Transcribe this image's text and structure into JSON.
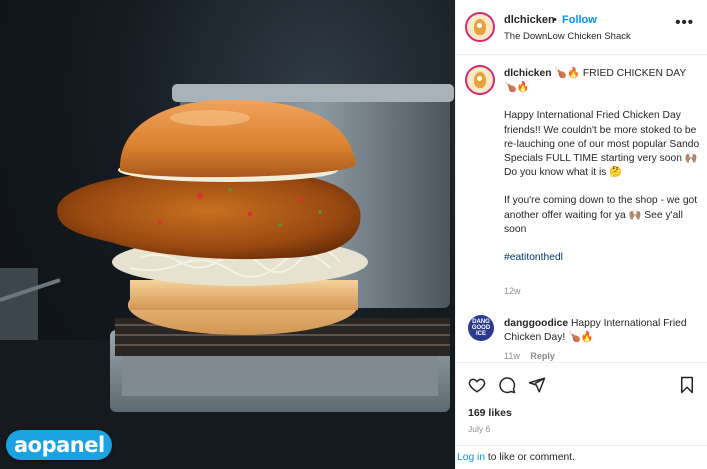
{
  "post": {
    "username": "dlchicken",
    "dot": "•",
    "follow_label": "Follow",
    "subtitle": "The DownLow Chicken Shack",
    "more_label": "•••"
  },
  "caption": {
    "username": "dlchicken",
    "headline": "🍗🔥 FRIED CHICKEN DAY 🍗🔥",
    "paragraph1": "Happy International Fried Chicken Day friends!! We couldn't be more stoked to be re-lauching one of our most popular Sando Specials FULL TIME starting very soon 🙌🏽 Do you know what it is 🤔",
    "paragraph2": "If you're coming down to the shop - we got another offer waiting for ya 🙌🏽 See y'all soon",
    "hashtag": "#eatitonthedl",
    "age": "12w"
  },
  "comment": {
    "avatar_text": "DANG GOOD ICE",
    "username": "danggoodice",
    "text": "Happy International Fried Chicken Day! 🍗🔥",
    "age": "11w",
    "reply_label": "Reply"
  },
  "actions": {
    "like_icon": "heart-icon",
    "comment_icon": "comment-icon",
    "share_icon": "send-icon",
    "save_icon": "bookmark-icon"
  },
  "stats": {
    "likes": "169 likes",
    "date": "July 6"
  },
  "footer": {
    "login_label": "Log in",
    "rest": " to like or comment."
  },
  "watermark": {
    "text": "aopanel"
  },
  "colors": {
    "link_blue": "#0095f6",
    "hashtag_blue": "#00376b",
    "muted": "#8e8e8e",
    "watermark": "#1aa3e0"
  }
}
